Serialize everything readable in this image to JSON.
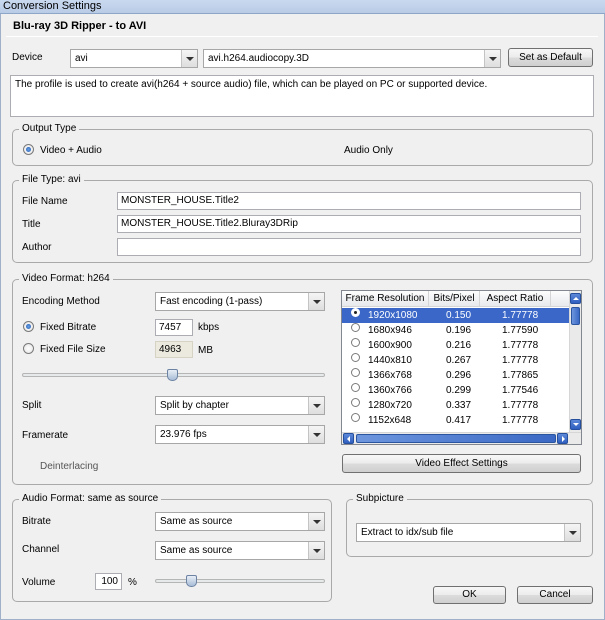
{
  "window": {
    "title": "Conversion Settings",
    "subtitle": "Blu-ray 3D Ripper - to AVI"
  },
  "device": {
    "label": "Device",
    "value": "avi",
    "profile": "avi.h264.audiocopy.3D",
    "set_default_label": "Set as Default",
    "description": "The profile is used to create avi(h264 + source audio) file, which can be played on PC or supported device."
  },
  "output_type": {
    "legend": "Output Type",
    "options": [
      {
        "label": "Video + Audio",
        "selected": true
      },
      {
        "label": "Audio Only",
        "selected": false
      }
    ]
  },
  "file_type": {
    "legend": "File Type: avi",
    "file_name_label": "File Name",
    "file_name_value": "MONSTER_HOUSE.Title2",
    "title_label": "Title",
    "title_value": "MONSTER_HOUSE.Title2.Bluray3DRip",
    "author_label": "Author",
    "author_value": ""
  },
  "video": {
    "legend": "Video Format: h264",
    "encoding_label": "Encoding Method",
    "encoding_value": "Fast encoding (1-pass)",
    "fixed_bitrate_label": "Fixed Bitrate",
    "fixed_bitrate_value": "7457",
    "bitrate_unit": "kbps",
    "fixed_size_label": "Fixed File Size",
    "fixed_size_value": "4963",
    "size_unit": "MB",
    "bitrate_mode": "fixed-bitrate",
    "quality_slider_level": 0.5,
    "split_label": "Split",
    "split_value": "Split by chapter",
    "framerate_label": "Framerate",
    "framerate_value": "23.976 fps",
    "deinterlacing_label": "Deinterlacing",
    "effect_button_label": "Video Effect Settings",
    "resolution_table": {
      "headers": [
        "Frame Resolution",
        "Bits/Pixel",
        "Aspect Ratio"
      ],
      "rows": [
        {
          "res": "1920x1080",
          "bpp": "0.150",
          "ratio": "1.77778",
          "selected": true
        },
        {
          "res": "1680x946",
          "bpp": "0.196",
          "ratio": "1.77590",
          "selected": false
        },
        {
          "res": "1600x900",
          "bpp": "0.216",
          "ratio": "1.77778",
          "selected": false
        },
        {
          "res": "1440x810",
          "bpp": "0.267",
          "ratio": "1.77778",
          "selected": false
        },
        {
          "res": "1366x768",
          "bpp": "0.296",
          "ratio": "1.77865",
          "selected": false
        },
        {
          "res": "1360x766",
          "bpp": "0.299",
          "ratio": "1.77546",
          "selected": false
        },
        {
          "res": "1280x720",
          "bpp": "0.337",
          "ratio": "1.77778",
          "selected": false
        },
        {
          "res": "1152x648",
          "bpp": "0.417",
          "ratio": "1.77778",
          "selected": false
        }
      ]
    }
  },
  "audio": {
    "legend": "Audio Format: same as source",
    "bitrate_label": "Bitrate",
    "bitrate_value": "Same as source",
    "channel_label": "Channel",
    "channel_value": "Same as source",
    "volume_label": "Volume",
    "volume_value": "100",
    "volume_unit": "%",
    "volume_slider_level": 0.2
  },
  "subpicture": {
    "legend": "Subpicture",
    "value": "Extract to idx/sub file"
  },
  "buttons": {
    "ok": "OK",
    "cancel": "Cancel"
  },
  "colors": {
    "selection": "#3b68c8",
    "titlebar": "#c9d9ef",
    "radio_on": "#1f58b0"
  }
}
